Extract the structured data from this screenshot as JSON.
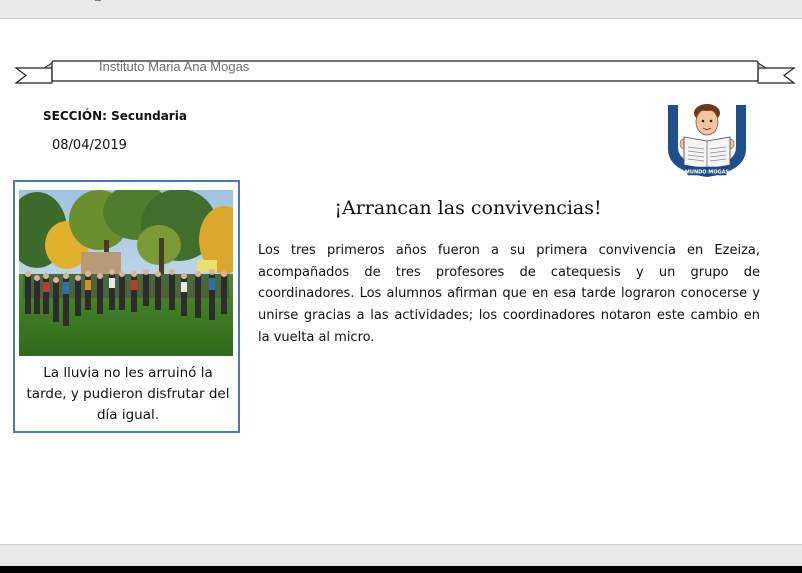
{
  "banner": {
    "school_name": "Instituto Maria Ana Mogas"
  },
  "header": {
    "section_label": "SECCIÓN: Secundaria",
    "date": "08/04/2019"
  },
  "logo": {
    "ribbon_text": "MUNDO MOGAS",
    "colors": {
      "shield": "#1f4e8c",
      "face": "#f1c59d",
      "hair": "#6b3a1e"
    }
  },
  "photo_box": {
    "caption": "La lluvia no les arruinó la tarde, y pudieron disfrutar del día igual.",
    "border_color": "#4a78b8"
  },
  "article": {
    "title": "¡Arrancan las convivencias!",
    "body": "Los tres primeros años fueron a su primera convivencia en Ezeiza, acompañados de tres profesores de catequesis y un grupo de coordinadores. Los alumnos afirman que en esa tarde lograron conocerse y unirse gracias a las actividades; los coordinadores notaron este cambio en la vuelta al micro."
  }
}
